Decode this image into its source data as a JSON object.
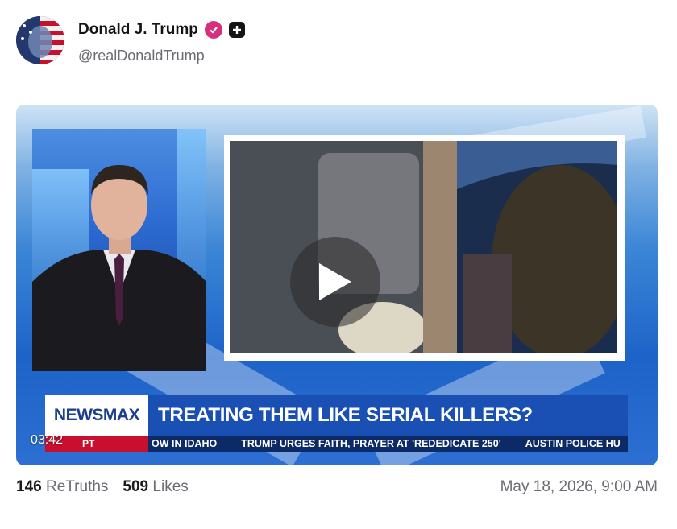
{
  "author": {
    "name": "Donald J. Trump",
    "handle": "@realDonaldTrump",
    "verified_color": "#d62f7d"
  },
  "video": {
    "network_logo": "NEWSMAX",
    "headline": "TREATING THEM LIKE SERIAL KILLERS?",
    "ticker_items": [
      "OW IN IDAHO",
      "TRUMP URGES FAITH, PRAYER AT 'REDEDICATE 250'",
      "AUSTIN POLICE HU"
    ],
    "ticker_label": "PT",
    "duration": "03:42",
    "accent_blue": "#1a4fb4",
    "accent_red": "#c8102e"
  },
  "stats": {
    "retruths_count": "146",
    "retruths_label": "ReTruths",
    "likes_count": "509",
    "likes_label": "Likes"
  },
  "timestamp": "May 18, 2026, 9:00 AM"
}
